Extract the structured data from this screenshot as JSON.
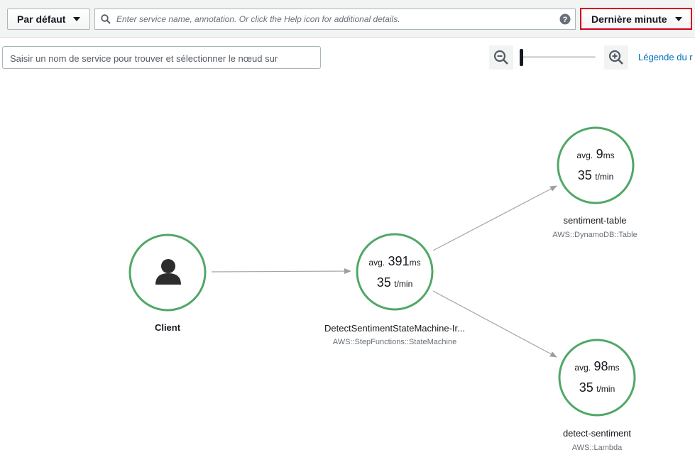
{
  "toolbar": {
    "group_label": "Par défaut",
    "search_placeholder": "Enter service name, annotation. Or click the Help icon for additional details.",
    "time_range_label": "Dernière minute"
  },
  "map_controls": {
    "node_search_placeholder": "Saisir un nom de service pour trouver et sélectionner le nœud sur",
    "legend_link": "Légende du r"
  },
  "nodes": {
    "client": {
      "name": "Client"
    },
    "state_machine": {
      "name": "DetectSentimentStateMachine-Ir...",
      "type": "AWS::StepFunctions::StateMachine",
      "avg_prefix": "avg.",
      "avg_value": "391",
      "avg_unit": "ms",
      "rate_value": "35",
      "rate_unit": "t/min"
    },
    "table": {
      "name": "sentiment-table",
      "type": "AWS::DynamoDB::Table",
      "avg_prefix": "avg.",
      "avg_value": "9",
      "avg_unit": "ms",
      "rate_value": "35",
      "rate_unit": "t/min"
    },
    "lambda": {
      "name": "detect-sentiment",
      "type": "AWS::Lambda",
      "avg_prefix": "avg.",
      "avg_value": "98",
      "avg_unit": "ms",
      "rate_value": "35",
      "rate_unit": "t/min"
    }
  },
  "colors": {
    "healthy_ring": "#4fa866",
    "highlight_border": "#d0021b",
    "link": "#0073bb"
  }
}
